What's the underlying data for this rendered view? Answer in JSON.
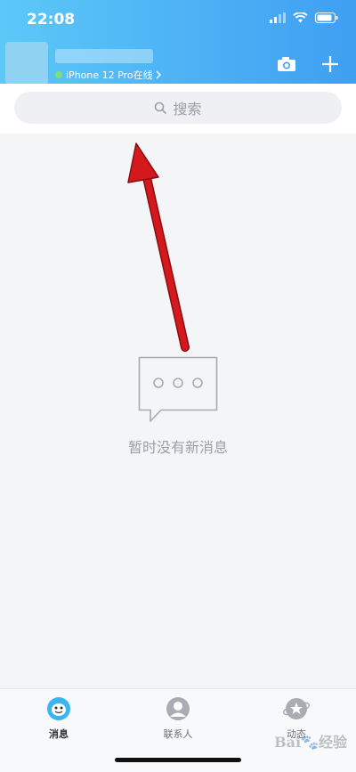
{
  "status_bar": {
    "time": "22:08"
  },
  "header": {
    "device_status": "iPhone 12 Pro在线",
    "camera_icon": "camera-icon",
    "add_icon": "plus-icon",
    "device_status_color": "#7ee07a"
  },
  "search": {
    "placeholder": "搜索"
  },
  "empty_state": {
    "message": "暂时没有新消息",
    "icon": "chat-bubble-icon"
  },
  "tabbar": {
    "items": [
      {
        "label": "消息",
        "icon": "qq-penguin-icon",
        "active": true
      },
      {
        "label": "联系人",
        "icon": "person-icon",
        "active": false
      },
      {
        "label": "动态",
        "icon": "star-planet-icon",
        "active": false
      }
    ]
  },
  "annotation": {
    "color": "#d4191e"
  },
  "colors": {
    "header_start": "#5cc8f8",
    "header_end": "#3f9ff2",
    "background": "#f4f5f7"
  }
}
